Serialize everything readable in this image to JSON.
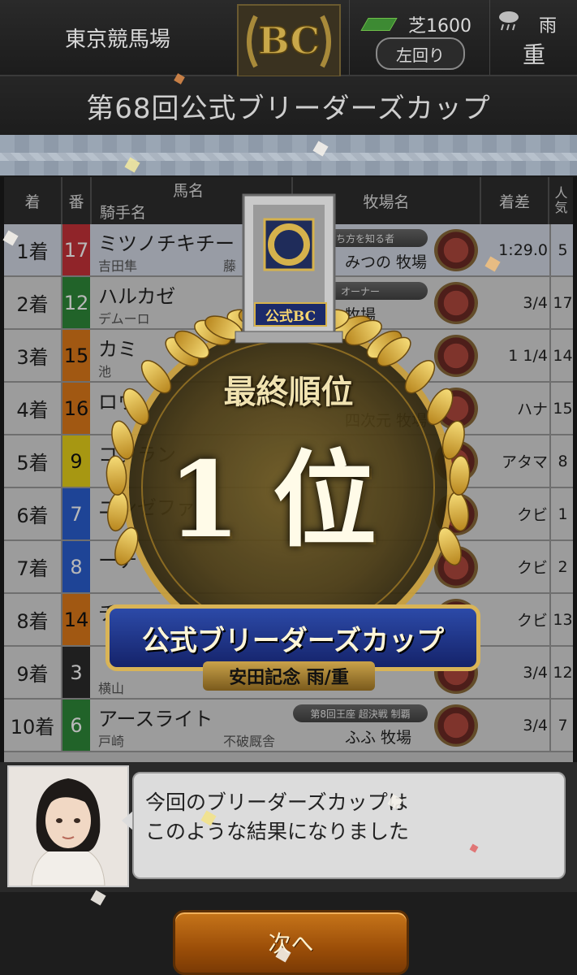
{
  "header": {
    "venue": "東京競馬場",
    "logo_text": "BC",
    "surface": "芝1600",
    "direction": "左回り",
    "weather": "雨",
    "track_condition": "重"
  },
  "race_title": "第68回公式ブリーダーズカップ",
  "table": {
    "headers": {
      "place": "着",
      "number": "番",
      "horse": "馬名",
      "jockey": "騎手名",
      "farm": "牧場名",
      "margin": "着差",
      "popularity": "人気"
    },
    "rows": [
      {
        "place": "1着",
        "number": "17",
        "color": "#c8323a",
        "horse": "ミツノチキチー",
        "jockey": "吉田隼",
        "owner": "藤",
        "badge": "勝ち方を知る者",
        "farm": "みつの 牧場",
        "margin": "1:29.0",
        "popularity": "5"
      },
      {
        "place": "2着",
        "number": "12",
        "color": "#2e8a3a",
        "horse": "ハルカゼ",
        "jockey": "デムーロ",
        "owner": "",
        "badge": "オーナー",
        "farm": "牧場",
        "margin": "3/4",
        "popularity": "17"
      },
      {
        "place": "3着",
        "number": "15",
        "color": "#e07a1a",
        "horse": "カミ",
        "jockey": "池",
        "owner": "",
        "badge": "",
        "farm": "",
        "margin": "1 1/4",
        "popularity": "14"
      },
      {
        "place": "4着",
        "number": "16",
        "color": "#e07a1a",
        "horse": "ロウ",
        "jockey": "",
        "owner": "",
        "badge": "",
        "farm": "四次元 牧場",
        "margin": "ハナ",
        "popularity": "15"
      },
      {
        "place": "5着",
        "number": "9",
        "color": "#e8d21a",
        "horse": "コクラン",
        "jockey": "",
        "owner": "",
        "badge": "",
        "farm": "",
        "margin": "アタマ",
        "popularity": "8"
      },
      {
        "place": "6着",
        "number": "7",
        "color": "#2a5fd0",
        "horse": "ニンゼファ",
        "jockey": "",
        "owner": "",
        "badge": "",
        "farm": "",
        "margin": "クビ",
        "popularity": "1"
      },
      {
        "place": "7着",
        "number": "8",
        "color": "#2a5fd0",
        "horse": "ーチ",
        "jockey": "",
        "owner": "",
        "badge": "",
        "farm": "",
        "margin": "クビ",
        "popularity": "2"
      },
      {
        "place": "8着",
        "number": "14",
        "color": "#e07a1a",
        "horse": "チ",
        "jockey": "",
        "owner": "",
        "badge": "",
        "farm": "",
        "margin": "クビ",
        "popularity": "13"
      },
      {
        "place": "9着",
        "number": "3",
        "color": "#2b2b2b",
        "horse": "",
        "jockey": "横山",
        "owner": "",
        "badge": "",
        "farm": "",
        "margin": "3/4",
        "popularity": "12"
      },
      {
        "place": "10着",
        "number": "6",
        "color": "#2e8a3a",
        "horse": "アースライト",
        "jockey": "戸崎",
        "owner": "不破厩舎",
        "badge": "第8回王座 超決戦 制覇",
        "farm": "ふふ 牧場",
        "margin": "3/4",
        "popularity": "7"
      }
    ]
  },
  "award": {
    "plate": "公式BC",
    "caption": "最終順位",
    "rank": "1位",
    "race_name": "公式ブリーダーズカップ",
    "race_sub": "安田記念 雨/重"
  },
  "dialog": {
    "line1": "今回のブリーダーズカップは",
    "line2": "このような結果になりました"
  },
  "next_button": "次へ"
}
